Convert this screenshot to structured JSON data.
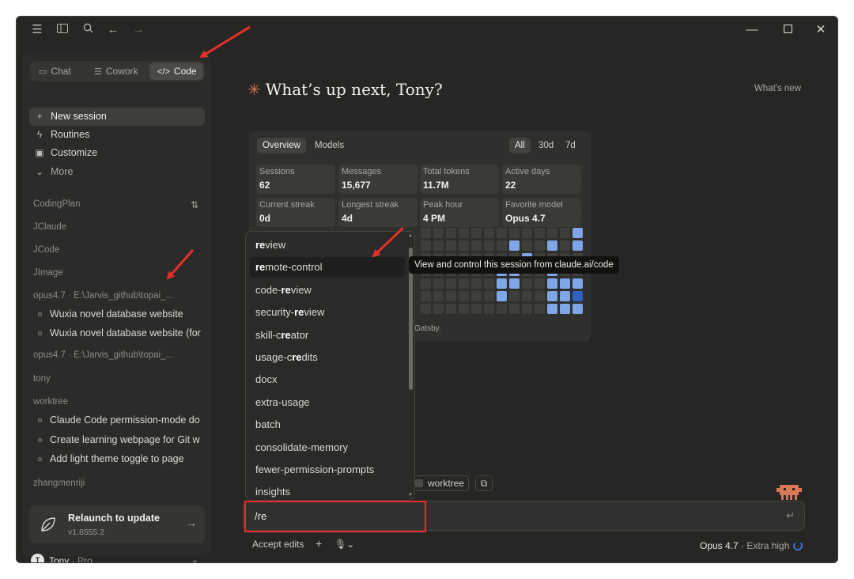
{
  "sidebar": {
    "modes": [
      {
        "label": "Chat",
        "icon": "chat-bubble-icon"
      },
      {
        "label": "Cowork",
        "icon": "checklist-icon"
      },
      {
        "label": "Code",
        "icon": "code-brackets-icon"
      }
    ],
    "nav": [
      {
        "label": "New session",
        "icon": "plus-icon"
      },
      {
        "label": "Routines",
        "icon": "lightning-icon"
      },
      {
        "label": "Customize",
        "icon": "briefcase-icon"
      },
      {
        "label": "More",
        "icon": "chevron-down-icon"
      }
    ],
    "groups": {
      "g1": "CodingPlan",
      "g2": "JClaude",
      "g3": "JCode",
      "g4": "JImage",
      "g5": "opus4.7 · E:\\Jarvis_github\\topai_...",
      "g6": "opus4.7 · E:\\Jarvis_github\\topai_...",
      "g7": "tony",
      "g8": "worktree",
      "g9": "zhangmenriji"
    },
    "sessions": {
      "s1": "Wuxia novel database website",
      "s2": "Wuxia novel database website (for",
      "s3": "Claude Code permission-mode do",
      "s4": "Create learning webpage for Git w",
      "s5": "Add light theme toggle to page"
    },
    "relaunch": {
      "title": "Relaunch to update",
      "version": "v1.8555.2"
    },
    "user": {
      "initial": "T",
      "name": "Tony",
      "plan": "· Pro"
    }
  },
  "main": {
    "greeting": "What’s up next, Tony?",
    "whats_new": "What's new",
    "stats": {
      "tabs": [
        "Overview",
        "Models"
      ],
      "ranges": [
        "All",
        "30d",
        "7d"
      ],
      "cards": [
        {
          "label": "Sessions",
          "value": "62"
        },
        {
          "label": "Messages",
          "value": "15,677"
        },
        {
          "label": "Total tokens",
          "value": "11.7M"
        },
        {
          "label": "Active days",
          "value": "22"
        },
        {
          "label": "Current streak",
          "value": "0d"
        },
        {
          "label": "Longest streak",
          "value": "4d"
        },
        {
          "label": "Peak hour",
          "value": "4 PM"
        },
        {
          "label": "Favorite model",
          "value": "Opus 4.7"
        }
      ],
      "footnote": "Gatsby."
    },
    "pills": {
      "worktree": "worktree"
    },
    "input": {
      "value": "/re"
    },
    "bottom": {
      "accept_edits": "Accept edits",
      "model": "Opus 4.7",
      "effort": "· Extra high"
    }
  },
  "menu": {
    "items": [
      {
        "pre": "",
        "hl": "re",
        "post": "view"
      },
      {
        "pre": "",
        "hl": "re",
        "post": "mote-control"
      },
      {
        "pre": "code-",
        "hl": "re",
        "post": "view"
      },
      {
        "pre": "security-",
        "hl": "re",
        "post": "view"
      },
      {
        "pre": "skill-c",
        "hl": "re",
        "post": "ator"
      },
      {
        "pre": "usage-c",
        "hl": "re",
        "post": "dits"
      },
      {
        "pre": "docx",
        "hl": "",
        "post": ""
      },
      {
        "pre": "extra-usage",
        "hl": "",
        "post": ""
      },
      {
        "pre": "batch",
        "hl": "",
        "post": ""
      },
      {
        "pre": "consolidate-memory",
        "hl": "",
        "post": ""
      },
      {
        "pre": "fewer-permission-prompts",
        "hl": "",
        "post": ""
      },
      {
        "pre": "insights",
        "hl": "",
        "post": ""
      }
    ],
    "tooltip": "View and control this session from claude.ai/code"
  },
  "colors": {
    "accent": "#d97757",
    "heat": "#3e3e3b",
    "heat_light": "#7fa6e6",
    "heat_mid": "#5b8ad8",
    "heat_dark": "#2f62c2",
    "annotation": "#e5302a"
  }
}
